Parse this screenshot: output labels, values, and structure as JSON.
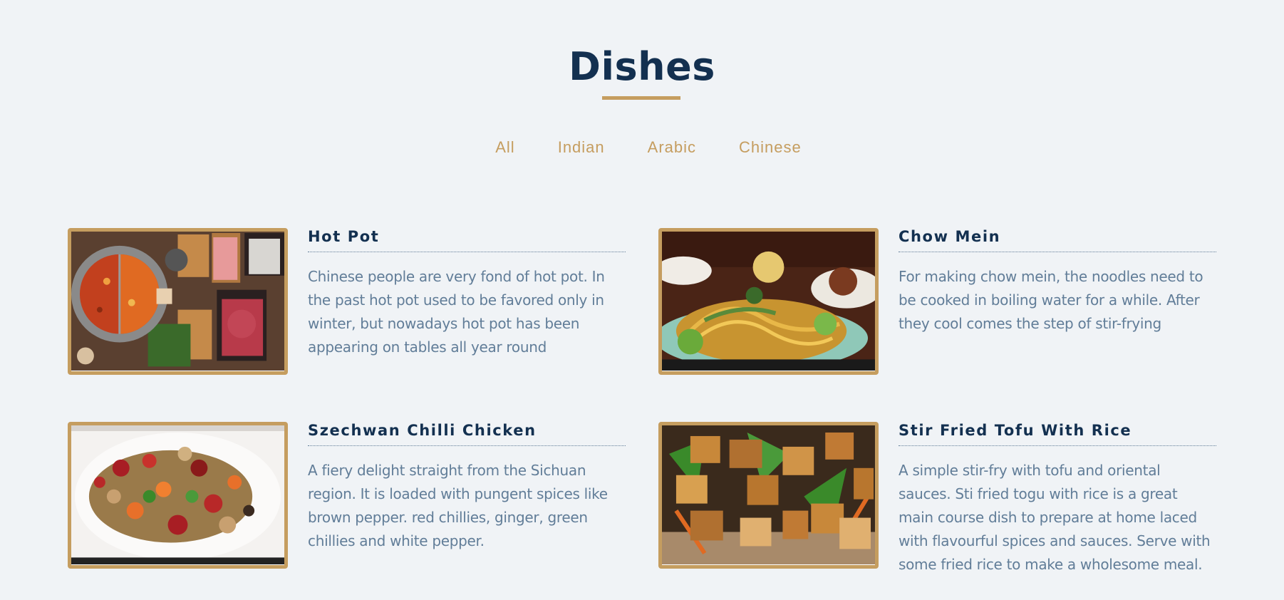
{
  "section": {
    "title": "Dishes"
  },
  "filters": [
    "All",
    "Indian",
    "Arabic",
    "Chinese"
  ],
  "colors": {
    "accent": "#c59d5f",
    "heading": "#133050",
    "body_text": "#617d98",
    "background": "#f0f3f6"
  },
  "menu": [
    {
      "title": "Hot Pot",
      "description": "Chinese people are very fond of hot pot. In the past hot pot used to be favored only in winter, but nowadays hot pot has been appearing on tables all year round",
      "image": "hot-pot-photo"
    },
    {
      "title": "Chow Mein",
      "description": "For making chow mein, the noodles need to be cooked in boiling water for a while. After they cool comes the step of stir-frying",
      "image": "chow-mein-photo"
    },
    {
      "title": "Szechwan Chilli Chicken",
      "description": "A fiery delight straight from the Sichuan region. It is loaded with pungent spices like brown pepper. red chillies, ginger, green chillies and white pepper.",
      "image": "szechwan-chicken-photo"
    },
    {
      "title": "Stir Fried Tofu With Rice",
      "description": "A simple stir-fry with tofu and oriental sauces. Sti fried togu with rice is a great main course dish to prepare at home laced with flavourful spices and sauces. Serve with some fried rice to make a wholesome meal.",
      "image": "stir-fried-tofu-photo"
    }
  ]
}
